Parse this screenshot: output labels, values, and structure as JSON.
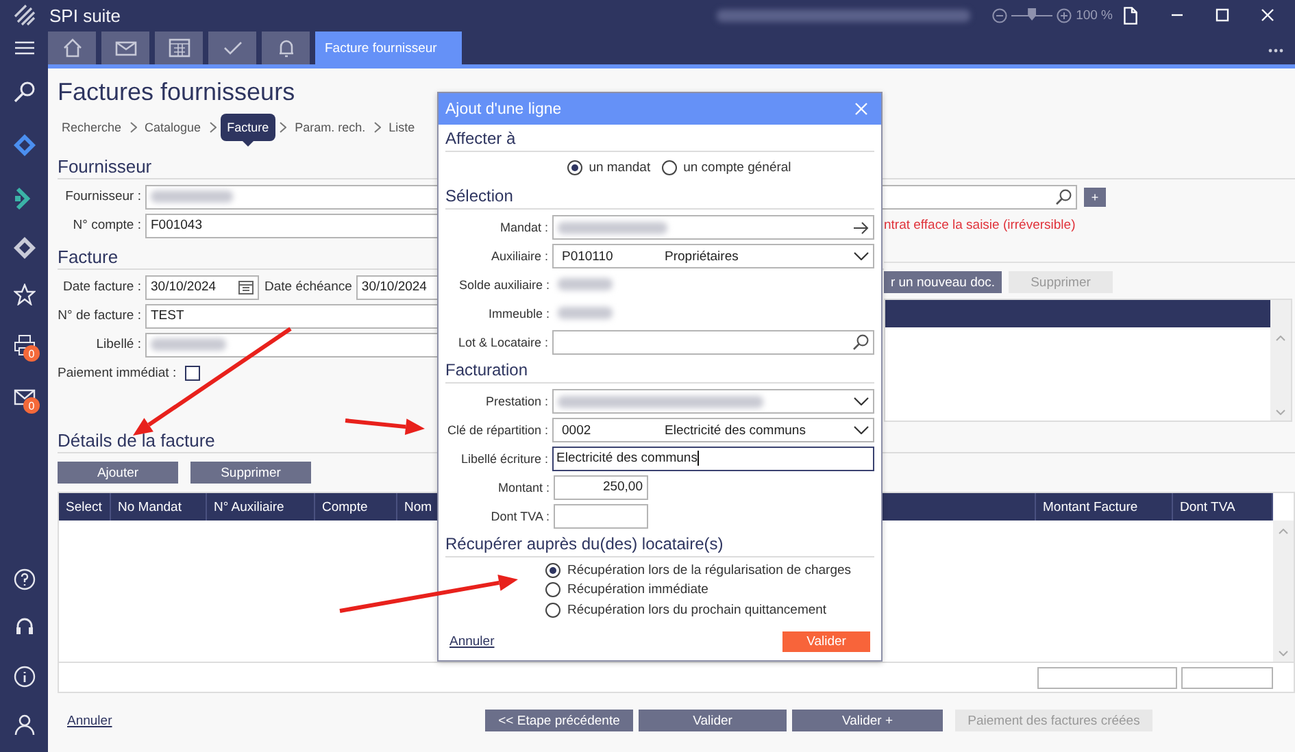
{
  "app": {
    "title": "SPI suite"
  },
  "user_info": {
    "kind": "redacted"
  },
  "zoom": {
    "level": 0.5,
    "reading": "100 %"
  },
  "tabs": [
    {
      "kind": "icon",
      "selected": false
    },
    {
      "kind": "icon",
      "selected": false
    },
    {
      "kind": "icon",
      "selected": false
    },
    {
      "kind": "icon",
      "selected": false
    },
    {
      "kind": "icon",
      "selected": false
    },
    {
      "kind": "text",
      "label": "Facture fournisseur",
      "selected": true
    }
  ],
  "sidebar": {
    "print_badge": "0",
    "mail_badge": "0"
  },
  "page": {
    "title": "Factures fournisseurs",
    "breadcrumb": [
      {
        "label": "Recherche",
        "selected": false
      },
      {
        "label": "Catalogue",
        "selected": false
      },
      {
        "label": "Facture",
        "selected": true
      },
      {
        "label": "Param. rech.",
        "selected": false
      },
      {
        "label": "Liste",
        "selected": false
      }
    ]
  },
  "fournisseur": {
    "heading": "Fournisseur",
    "supplier": {
      "label": "Fournisseur :",
      "kind": "redacted"
    },
    "account": {
      "label": "N° compte :",
      "value": "F001043"
    },
    "add_button": "+",
    "warning": "ntrat efface la saisie (irréversible)"
  },
  "facture": {
    "heading": "Facture",
    "date_facture": {
      "label": "Date facture :",
      "value": "30/10/2024"
    },
    "date_echeance": {
      "label": "Date échéance",
      "value": "30/10/2024"
    },
    "numero": {
      "label": "N° de facture :",
      "value": "TEST"
    },
    "libelle": {
      "label": "Libellé :",
      "kind": "redacted"
    },
    "paiement_immediat": {
      "label": "Paiement immédiat :",
      "checked": false
    }
  },
  "documents": {
    "buttons": [
      {
        "label": "r un nouveau doc.",
        "disabled": false
      },
      {
        "label": "Supprimer",
        "disabled": true
      }
    ]
  },
  "details": {
    "heading": "Détails de la facture",
    "buttons": [
      "Ajouter",
      "Supprimer"
    ],
    "columns": [
      "Select",
      "No Mandat",
      "N° Auxiliaire",
      "Compte",
      "Nom",
      "Montant Facture",
      "Dont TVA"
    ]
  },
  "footer": {
    "cancel": "Annuler",
    "buttons": [
      {
        "label": "<< Etape précédente",
        "disabled": false
      },
      {
        "label": "Valider",
        "disabled": false
      },
      {
        "label": "Valider +",
        "disabled": false
      },
      {
        "label": "Paiement des factures créées",
        "disabled": true
      }
    ]
  },
  "dialog": {
    "title": "Ajout d'une ligne",
    "sections": [
      {
        "heading": "Affecter à",
        "kind": "radios_inline",
        "options": [
          {
            "label": "un mandat",
            "selected": true
          },
          {
            "label": "un compte général",
            "selected": false
          }
        ]
      },
      {
        "heading": "Sélection",
        "kind": "fields",
        "fields": [
          {
            "label": "Mandat :",
            "kind": "redacted_input"
          },
          {
            "label": "Auxiliaire :",
            "kind": "select",
            "code": "P010110",
            "value": "Propriétaires"
          },
          {
            "label": "Solde auxiliaire :",
            "kind": "redacted"
          },
          {
            "label": "Immeuble :",
            "kind": "redacted"
          },
          {
            "label": "Lot & Locataire :",
            "kind": "search"
          }
        ]
      },
      {
        "heading": "Facturation",
        "kind": "fields",
        "fields": [
          {
            "label": "Prestation :",
            "kind": "redacted_select"
          },
          {
            "label": "Clé de répartition :",
            "kind": "select",
            "code": "0002",
            "value": "Electricité des communs"
          },
          {
            "label": "Libellé écriture :",
            "kind": "input",
            "value": "Electricité des communs",
            "focused": true
          },
          {
            "label": "Montant :",
            "kind": "amount",
            "value": "250,00"
          },
          {
            "label": "Dont TVA :",
            "kind": "amount"
          }
        ]
      },
      {
        "heading": "Récupérer auprès du(des) locataire(s)",
        "kind": "radios",
        "options": [
          {
            "label": "Récupération lors de la régularisation de charges",
            "selected": true
          },
          {
            "label": "Récupération immédiate",
            "selected": false
          },
          {
            "label": "Récupération lors du prochain quittancement",
            "selected": false
          }
        ]
      }
    ],
    "cancel": "Annuler",
    "submit": "Valider"
  },
  "annotations": [
    {
      "kind": "arrow"
    },
    {
      "kind": "arrow"
    },
    {
      "kind": "arrow"
    }
  ]
}
